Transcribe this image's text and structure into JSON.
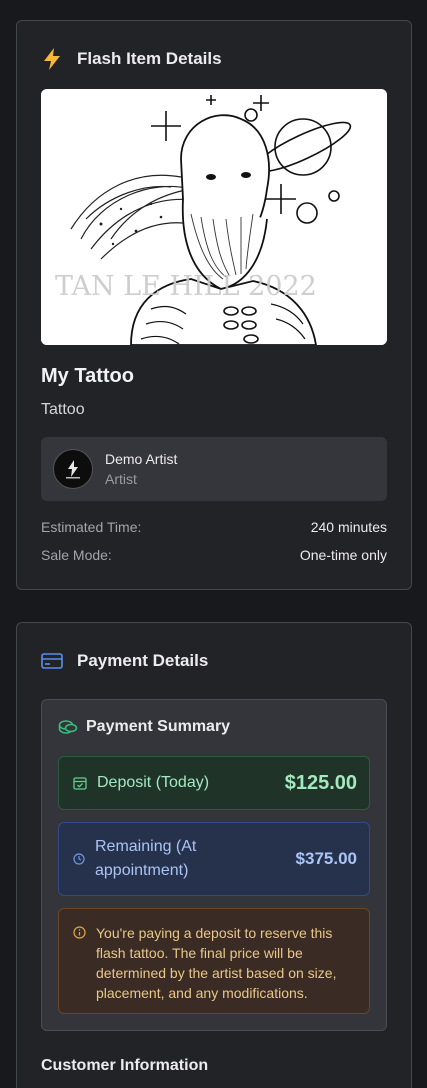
{
  "flash_card": {
    "title": "Flash Item Details",
    "image": {
      "watermark": "TAN   LE   HILL 2022"
    },
    "item_name": "My Tattoo",
    "item_type": "Tattoo",
    "artist": {
      "name": "Demo Artist",
      "role": "Artist"
    },
    "meta": [
      {
        "label": "Estimated Time:",
        "value": "240 minutes"
      },
      {
        "label": "Sale Mode:",
        "value": "One-time only"
      }
    ]
  },
  "payment_card": {
    "title": "Payment Details",
    "summary": {
      "title": "Payment Summary",
      "deposit_label": "Deposit (Today)",
      "deposit_amount": "$125.00",
      "remaining_label": "Remaining (At appointment)",
      "remaining_amount": "$375.00",
      "notice": "You're paying a deposit to reserve this flash tattoo. The final price will be determined by the artist based on size, placement, and any modifications."
    },
    "customer_title": "Customer Information"
  },
  "colors": {
    "bolt": "#f5b93a",
    "card_icon": "#5b8def",
    "coins": "#34c27a",
    "deposit_text": "#a3e9bd",
    "remaining_text": "#a9c4f5",
    "notice_text": "#e8c788"
  }
}
